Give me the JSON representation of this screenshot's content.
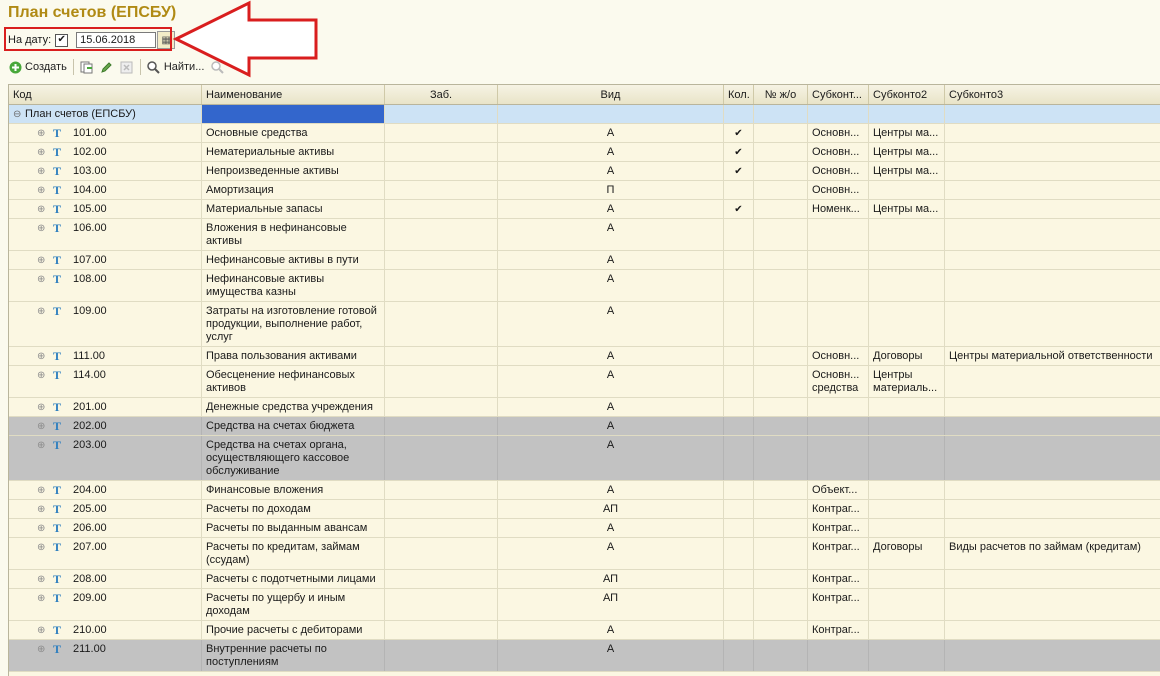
{
  "title": "План счетов (ЕПСБУ)",
  "date_filter": {
    "label": "На дату:",
    "checked": true,
    "value": "15.06.2018"
  },
  "toolbar": {
    "create": "Создать",
    "find": "Найти..."
  },
  "columns": [
    "Код",
    "Наименование",
    "Заб.",
    "Вид",
    "Кол.",
    "№ ж/о",
    "Субконт...",
    "Субконто2",
    "Субконто3"
  ],
  "root": {
    "label": "План счетов (ЕПСБУ)"
  },
  "rows": [
    {
      "code": "101.00",
      "name": [
        "Основные средства"
      ],
      "vid": "А",
      "kol": true,
      "s1": [
        "Основн..."
      ],
      "s2": [
        "Центры ма..."
      ],
      "s3": "",
      "gray": false
    },
    {
      "code": "102.00",
      "name": [
        "Нематериальные активы"
      ],
      "vid": "А",
      "kol": true,
      "s1": [
        "Основн..."
      ],
      "s2": [
        "Центры ма..."
      ],
      "s3": "",
      "gray": false
    },
    {
      "code": "103.00",
      "name": [
        "Непроизведенные активы"
      ],
      "vid": "А",
      "kol": true,
      "s1": [
        "Основн..."
      ],
      "s2": [
        "Центры ма..."
      ],
      "s3": "",
      "gray": false
    },
    {
      "code": "104.00",
      "name": [
        "Амортизация"
      ],
      "vid": "П",
      "kol": false,
      "s1": [
        "Основн..."
      ],
      "s2": [],
      "s3": "",
      "gray": false
    },
    {
      "code": "105.00",
      "name": [
        "Материальные запасы"
      ],
      "vid": "А",
      "kol": true,
      "s1": [
        "Номенк..."
      ],
      "s2": [
        "Центры ма..."
      ],
      "s3": "",
      "gray": false
    },
    {
      "code": "106.00",
      "name": [
        "Вложения в нефинансовые",
        "активы"
      ],
      "vid": "А",
      "kol": false,
      "s1": [],
      "s2": [],
      "s3": "",
      "gray": false
    },
    {
      "code": "107.00",
      "name": [
        "Нефинансовые активы в пути"
      ],
      "vid": "А",
      "kol": false,
      "s1": [],
      "s2": [],
      "s3": "",
      "gray": false
    },
    {
      "code": "108.00",
      "name": [
        "Нефинансовые активы",
        "имущества казны"
      ],
      "vid": "А",
      "kol": false,
      "s1": [],
      "s2": [],
      "s3": "",
      "gray": false
    },
    {
      "code": "109.00",
      "name": [
        "Затраты на изготовление готовой",
        "продукции, выполнение работ,",
        "услуг"
      ],
      "vid": "А",
      "kol": false,
      "s1": [],
      "s2": [],
      "s3": "",
      "gray": false
    },
    {
      "code": "111.00",
      "name": [
        "Права пользования активами"
      ],
      "vid": "А",
      "kol": false,
      "s1": [
        "Основн..."
      ],
      "s2": [
        "Договоры"
      ],
      "s3": "Центры материальной ответственности",
      "gray": false
    },
    {
      "code": "114.00",
      "name": [
        "Обесценение нефинансовых",
        "активов"
      ],
      "vid": "А",
      "kol": false,
      "s1": [
        "Основн...",
        "средства"
      ],
      "s2": [
        "Центры",
        "материаль..."
      ],
      "s3": "",
      "gray": false
    },
    {
      "code": "201.00",
      "name": [
        "Денежные средства учреждения"
      ],
      "vid": "А",
      "kol": false,
      "s1": [],
      "s2": [],
      "s3": "",
      "gray": false
    },
    {
      "code": "202.00",
      "name": [
        "Средства на счетах бюджета"
      ],
      "vid": "А",
      "kol": false,
      "s1": [],
      "s2": [],
      "s3": "",
      "gray": true
    },
    {
      "code": "203.00",
      "name": [
        "Средства на счетах органа,",
        "осуществляющего кассовое",
        "обслуживание"
      ],
      "vid": "А",
      "kol": false,
      "s1": [],
      "s2": [],
      "s3": "",
      "gray": true
    },
    {
      "code": "204.00",
      "name": [
        "Финансовые вложения"
      ],
      "vid": "А",
      "kol": false,
      "s1": [
        "Объект..."
      ],
      "s2": [],
      "s3": "",
      "gray": false
    },
    {
      "code": "205.00",
      "name": [
        "Расчеты по доходам"
      ],
      "vid": "АП",
      "kol": false,
      "s1": [
        "Контраг..."
      ],
      "s2": [],
      "s3": "",
      "gray": false
    },
    {
      "code": "206.00",
      "name": [
        "Расчеты по выданным авансам"
      ],
      "vid": "А",
      "kol": false,
      "s1": [
        "Контраг..."
      ],
      "s2": [],
      "s3": "",
      "gray": false
    },
    {
      "code": "207.00",
      "name": [
        "Расчеты по кредитам, займам",
        "(ссудам)"
      ],
      "vid": "А",
      "kol": false,
      "s1": [
        "Контраг..."
      ],
      "s2": [
        "Договоры"
      ],
      "s3": "Виды расчетов по займам (кредитам)",
      "gray": false
    },
    {
      "code": "208.00",
      "name": [
        "Расчеты с подотчетными лицами"
      ],
      "vid": "АП",
      "kol": false,
      "s1": [
        "Контраг..."
      ],
      "s2": [],
      "s3": "",
      "gray": false
    },
    {
      "code": "209.00",
      "name": [
        "Расчеты по ущербу и иным",
        "доходам"
      ],
      "vid": "АП",
      "kol": false,
      "s1": [
        "Контраг..."
      ],
      "s2": [],
      "s3": "",
      "gray": false
    },
    {
      "code": "210.00",
      "name": [
        "Прочие расчеты с дебиторами"
      ],
      "vid": "А",
      "kol": false,
      "s1": [
        "Контраг..."
      ],
      "s2": [],
      "s3": "",
      "gray": false
    },
    {
      "code": "211.00",
      "name": [
        "Внутренние расчеты по",
        "поступлениям"
      ],
      "vid": "А",
      "kol": false,
      "s1": [],
      "s2": [],
      "s3": "",
      "gray": true
    }
  ]
}
